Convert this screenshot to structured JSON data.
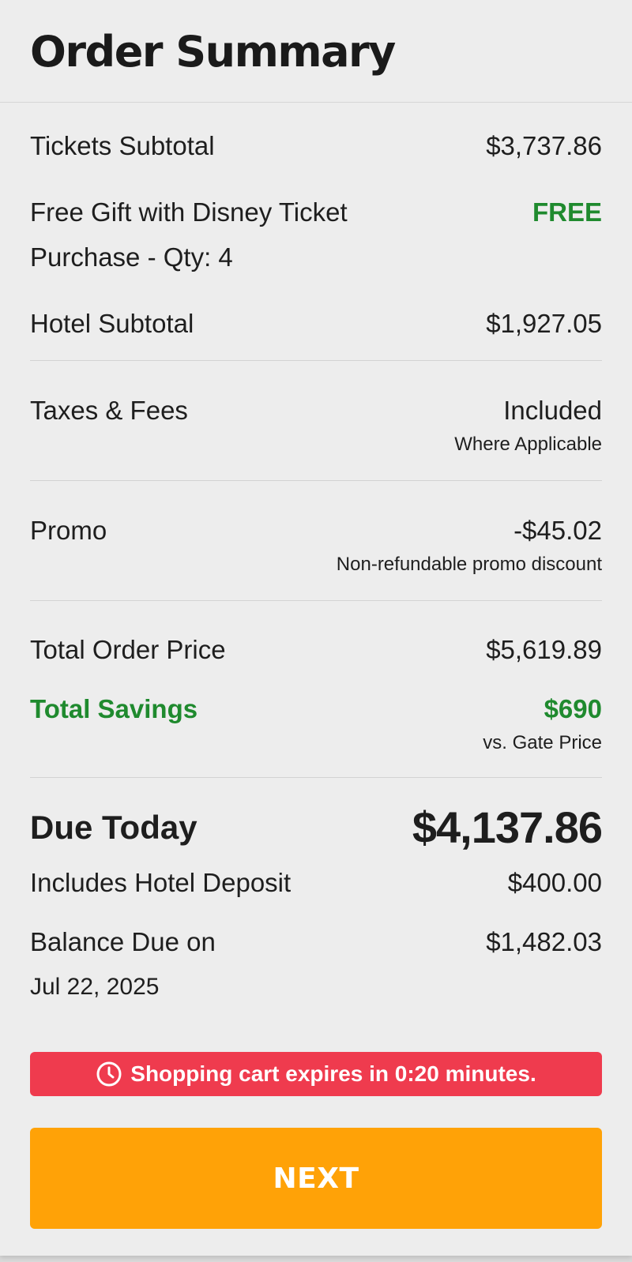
{
  "header": {
    "title": "Order Summary"
  },
  "lines": {
    "tickets_subtotal": {
      "label": "Tickets Subtotal",
      "value": "$3,737.86"
    },
    "free_gift": {
      "label_line1": "Free Gift with Disney Ticket",
      "label_line2": "Purchase - Qty:  4",
      "value": "FREE"
    },
    "hotel_subtotal": {
      "label": "Hotel Subtotal",
      "value": "$1,927.05"
    },
    "taxes": {
      "label": "Taxes & Fees",
      "value": "Included",
      "note": "Where Applicable"
    },
    "promo": {
      "label": "Promo",
      "value": "-$45.02",
      "note": "Non-refundable promo discount"
    },
    "total_order": {
      "label": "Total Order Price",
      "value": "$5,619.89"
    },
    "total_savings": {
      "label": "Total Savings",
      "value": "$690",
      "note": "vs. Gate Price"
    },
    "due_today": {
      "label": "Due Today",
      "value": "$4,137.86"
    },
    "hotel_deposit": {
      "label": "Includes Hotel Deposit",
      "value": "$400.00"
    },
    "balance_due": {
      "label_line1": "Balance Due on",
      "label_line2": "Jul 22, 2025",
      "value": "$1,482.03"
    }
  },
  "alert": {
    "icon": "clock-icon",
    "text": "Shopping cart expires in 0:20 minutes."
  },
  "next_button": {
    "label": "NEXT"
  },
  "colors": {
    "accent_green": "#1f8a2e",
    "alert_red": "#ef3b4e",
    "button_orange": "#ffa207"
  }
}
